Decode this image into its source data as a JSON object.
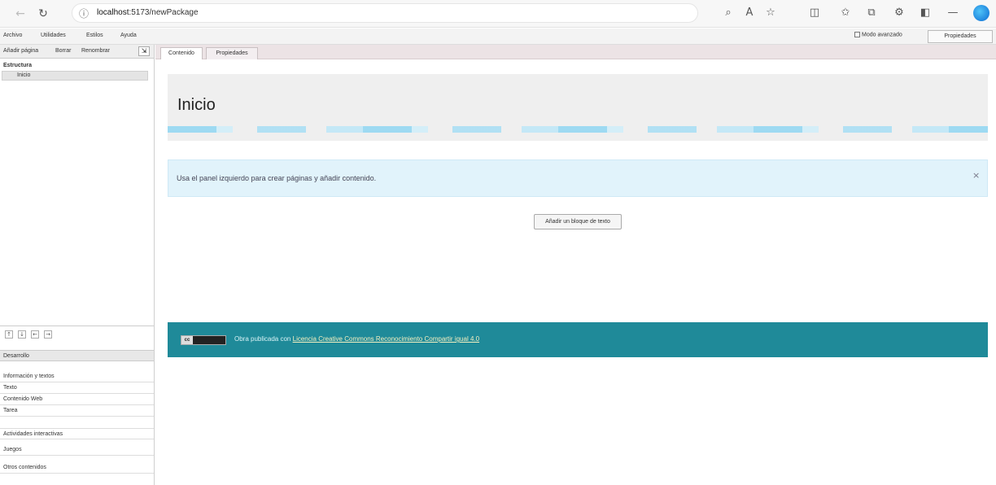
{
  "browser": {
    "url_host": "localhost",
    "url_rest": ":5173/newPackage"
  },
  "menubar": {
    "items": [
      "Archivo",
      "Utilidades",
      "Estilos",
      "Ayuda"
    ],
    "advanced_label": "Modo avanzado",
    "properties_button": "Propiedades"
  },
  "sidebar": {
    "toolbar": [
      "Añadir página",
      "Borrar",
      "Renombrar"
    ],
    "tree_title": "Estructura",
    "tree_root": "Inicio",
    "group_select": "Desarrollo",
    "idevices": [
      "Información y textos",
      "Texto",
      "Contenido Web",
      "Tarea",
      "Actividades interactivas",
      "Juegos",
      "Otros contenidos"
    ]
  },
  "tabs": {
    "content": "Contenido",
    "properties": "Propiedades"
  },
  "page": {
    "title": "Inicio",
    "alert_text": "Usa el panel izquierdo para crear páginas y añadir contenido.",
    "add_button": "Añadir un bloque de texto",
    "footer_prefix": "Obra publicada con",
    "footer_license": "Licencia Creative Commons Reconocimiento Compartir igual 4.0",
    "cc_badge": "cc"
  }
}
